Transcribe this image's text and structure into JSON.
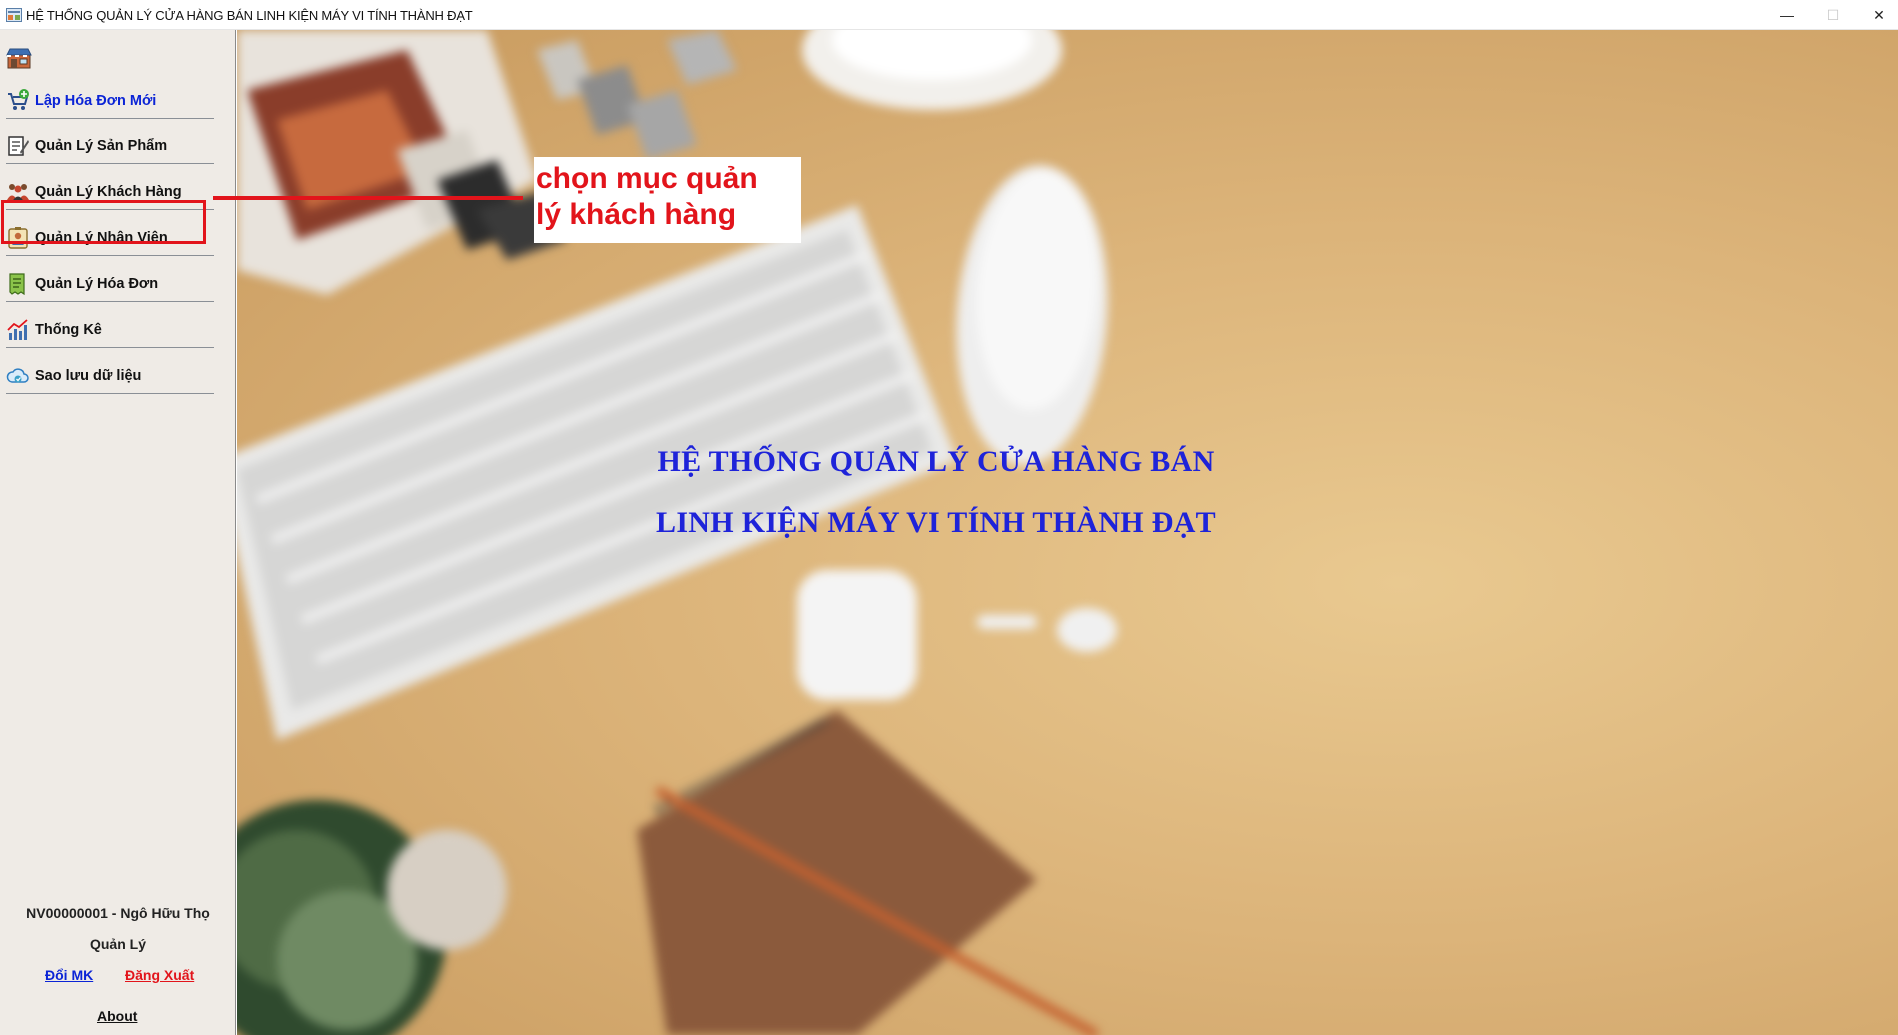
{
  "window": {
    "title": "HỆ THỐNG QUẢN LÝ CỬA HÀNG BÁN LINH KIỆN MÁY VI TÍNH THÀNH ĐẠT",
    "minimize_glyph": "—",
    "maximize_glyph": "☐",
    "close_glyph": "✕"
  },
  "sidebar": {
    "items": [
      {
        "label": "Lập Hóa Đơn Mới",
        "icon": "cart-add-icon",
        "color": "#0b24d6"
      },
      {
        "label": "Quản Lý Sản Phẩm",
        "icon": "notepad-pen-icon"
      },
      {
        "label": "Quản Lý Khách Hàng",
        "icon": "customers-group-icon"
      },
      {
        "label": "Quản Lý Nhân Viên",
        "icon": "employee-badge-icon"
      },
      {
        "label": "Quản Lý Hóa Đơn",
        "icon": "invoice-icon"
      },
      {
        "label": "Thống Kê",
        "icon": "bar-chart-icon"
      },
      {
        "label": "Sao lưu dữ liệu",
        "icon": "cloud-backup-icon"
      }
    ],
    "user_info": "NV00000001 - Ngô Hữu  Thọ",
    "role": "Quản Lý",
    "change_password": "Đổi MK",
    "logout": "Đăng Xuất",
    "about": "About"
  },
  "main": {
    "title_line1": "HỆ THỐNG QUẢN LÝ CỬA HÀNG BÁN",
    "title_line2": "LINH KIỆN MÁY VI TÍNH THÀNH ĐẠT",
    "title_color": "#1e23d9"
  },
  "annotation": {
    "line1": "chọn mục quản",
    "line2": "lý khách hàng",
    "color": "#e2141b"
  }
}
